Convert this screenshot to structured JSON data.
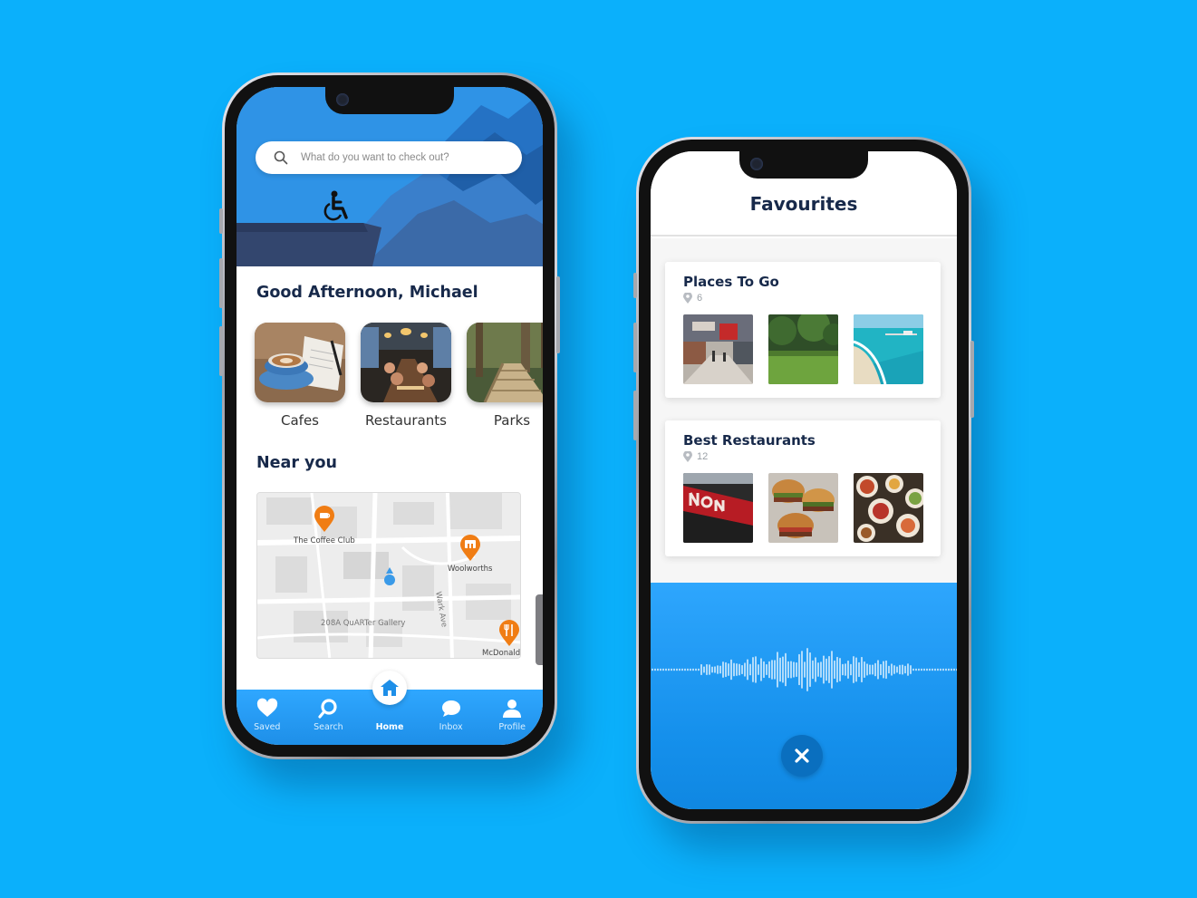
{
  "left_phone": {
    "search": {
      "placeholder": "What do you want to check out?"
    },
    "greeting": "Good Afternoon, Michael",
    "categories": [
      {
        "label": "Cafes"
      },
      {
        "label": "Restaurants"
      },
      {
        "label": "Parks"
      }
    ],
    "near_you": {
      "title": "Near you",
      "map_labels": {
        "coffee_club": "The Coffee Club",
        "woolworths": "Woolworths",
        "street": "Wark Ave",
        "gallery": "208A QuARTer Gallery",
        "mcdonalds": "McDonald"
      }
    },
    "tabbar": [
      {
        "label": "Saved",
        "icon": "heart-icon"
      },
      {
        "label": "Search",
        "icon": "search-icon"
      },
      {
        "label": "Home",
        "icon": "home-icon",
        "active": true
      },
      {
        "label": "Inbox",
        "icon": "chat-bubble-icon"
      },
      {
        "label": "Profile",
        "icon": "person-icon"
      }
    ]
  },
  "right_phone": {
    "title": "Favourites",
    "lists": [
      {
        "title": "Places To Go",
        "count": "6"
      },
      {
        "title": "Best Restaurants",
        "count": "12"
      }
    ],
    "close_icon": "close-icon"
  },
  "colors": {
    "background": "#0bb0fb",
    "navy_text": "#17294a",
    "tab_blue": "#1e8fe8",
    "pin_orange": "#f07d14"
  }
}
